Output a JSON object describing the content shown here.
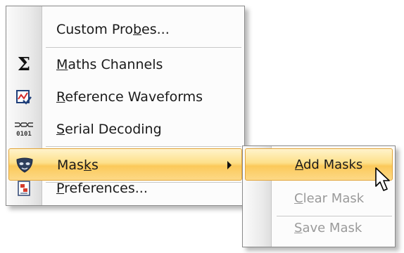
{
  "menu": {
    "items": [
      {
        "pre": "Custom Pro",
        "key": "b",
        "post": "es...",
        "icon": "none"
      },
      {
        "pre": "",
        "key": "M",
        "post": "aths Channels",
        "icon": "sigma-icon"
      },
      {
        "pre": "",
        "key": "R",
        "post": "eference Waveforms",
        "icon": "reference-waveform-icon"
      },
      {
        "pre": "",
        "key": "S",
        "post": "erial Decoding",
        "icon": "serial-decoding-icon"
      },
      {
        "pre": "Mas",
        "key": "k",
        "post": "s",
        "icon": "mask-icon"
      },
      {
        "pre": "",
        "key": "P",
        "post": "references...",
        "icon": "preferences-icon"
      }
    ],
    "serial_icon_text": "0101",
    "sigma_glyph": "Σ"
  },
  "submenu": {
    "items": [
      {
        "pre": "",
        "key": "A",
        "post": "dd Masks",
        "state": "highlighted"
      },
      {
        "pre": "",
        "key": "C",
        "post": "lear Mask",
        "state": "disabled"
      },
      {
        "pre": "",
        "key": "S",
        "post": "ave Mask",
        "state": "disabled"
      }
    ]
  },
  "colors": {
    "highlight_top": "#fff3cc",
    "highlight_mid": "#fbc95a",
    "highlight_border": "#e2a53c",
    "disabled_text": "#9a9a9a",
    "menu_border": "#8a8a8a"
  }
}
